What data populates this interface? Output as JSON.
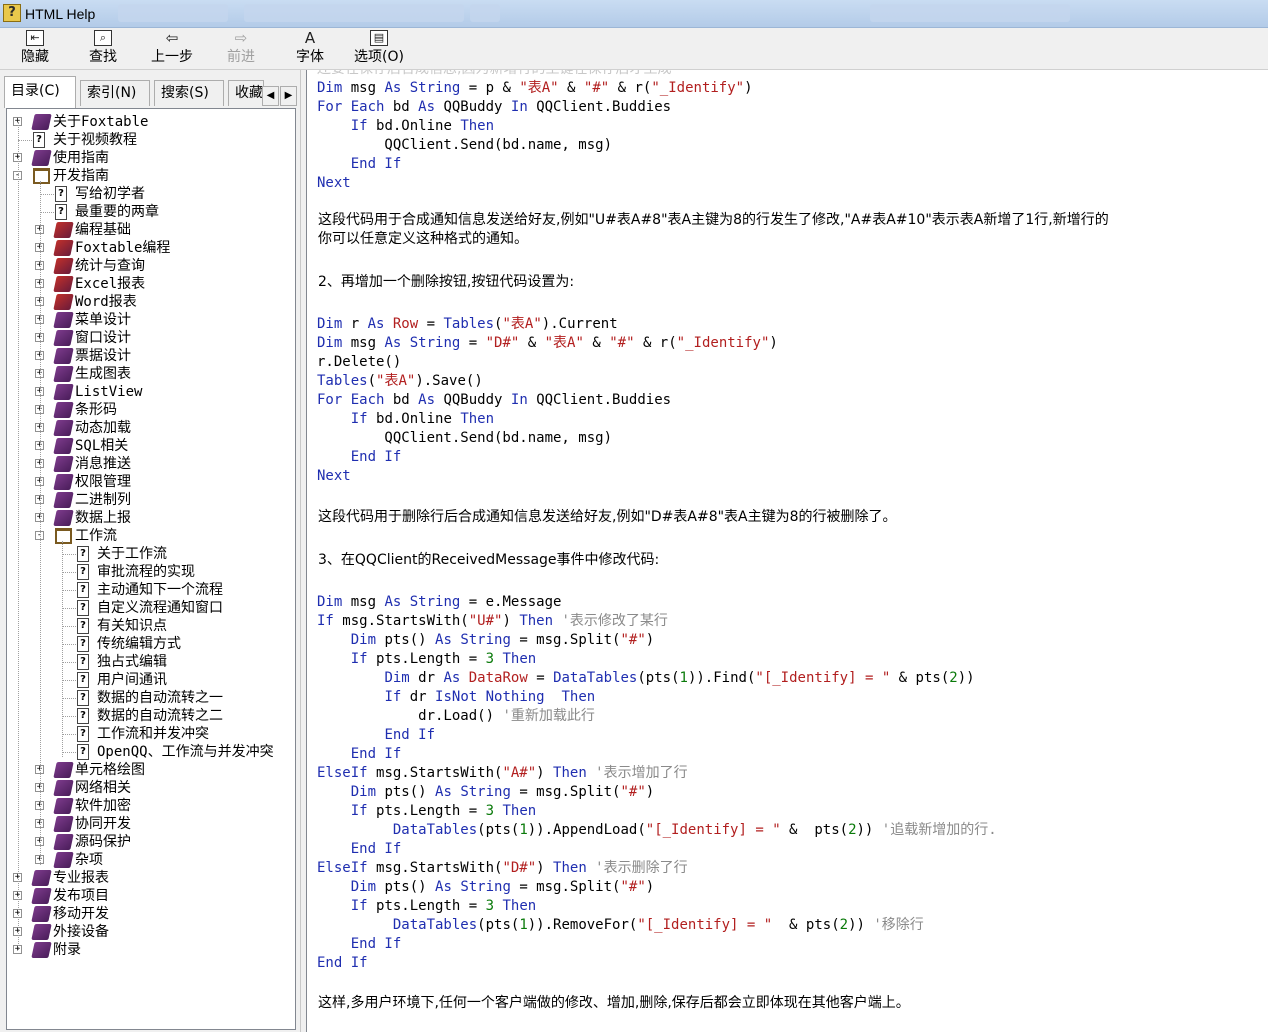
{
  "window": {
    "title": "HTML Help"
  },
  "toolbar": {
    "hide": "隐藏",
    "find": "查找",
    "back": "上一步",
    "forward": "前进",
    "font": "字体",
    "options": "选项(O)"
  },
  "nav": {
    "tabs": [
      "目录(C)",
      "索引(N)",
      "搜索(S)",
      "收藏"
    ],
    "tree": [
      {
        "label": "关于Foxtable",
        "level": 0,
        "icon": "book",
        "expander": "+"
      },
      {
        "label": "关于视频教程",
        "level": 0,
        "icon": "page",
        "expander": ""
      },
      {
        "label": "使用指南",
        "level": 0,
        "icon": "book",
        "expander": "+"
      },
      {
        "label": "开发指南",
        "level": 0,
        "icon": "openbook",
        "expander": "-"
      },
      {
        "label": "写给初学者",
        "level": 1,
        "icon": "page",
        "expander": ""
      },
      {
        "label": "最重要的两章",
        "level": 1,
        "icon": "page",
        "expander": ""
      },
      {
        "label": "编程基础",
        "level": 1,
        "icon": "book-red",
        "expander": "+"
      },
      {
        "label": "Foxtable编程",
        "level": 1,
        "icon": "book-red",
        "expander": "+"
      },
      {
        "label": "统计与查询",
        "level": 1,
        "icon": "book-red",
        "expander": "+"
      },
      {
        "label": "Excel报表",
        "level": 1,
        "icon": "book-red",
        "expander": "+"
      },
      {
        "label": "Word报表",
        "level": 1,
        "icon": "book-red",
        "expander": "+"
      },
      {
        "label": "菜单设计",
        "level": 1,
        "icon": "book",
        "expander": "+"
      },
      {
        "label": "窗口设计",
        "level": 1,
        "icon": "book",
        "expander": "+"
      },
      {
        "label": "票据设计",
        "level": 1,
        "icon": "book",
        "expander": "+"
      },
      {
        "label": "生成图表",
        "level": 1,
        "icon": "book",
        "expander": "+"
      },
      {
        "label": "ListView",
        "level": 1,
        "icon": "book",
        "expander": "+"
      },
      {
        "label": "条形码",
        "level": 1,
        "icon": "book",
        "expander": "+"
      },
      {
        "label": "动态加载",
        "level": 1,
        "icon": "book",
        "expander": "+"
      },
      {
        "label": "SQL相关",
        "level": 1,
        "icon": "book",
        "expander": "+"
      },
      {
        "label": "消息推送",
        "level": 1,
        "icon": "book",
        "expander": "+"
      },
      {
        "label": "权限管理",
        "level": 1,
        "icon": "book",
        "expander": "+"
      },
      {
        "label": "二进制列",
        "level": 1,
        "icon": "book",
        "expander": "+"
      },
      {
        "label": "数据上报",
        "level": 1,
        "icon": "book",
        "expander": "+"
      },
      {
        "label": "工作流",
        "level": 1,
        "icon": "openbook",
        "expander": "-"
      },
      {
        "label": "关于工作流",
        "level": 2,
        "icon": "page",
        "expander": ""
      },
      {
        "label": "审批流程的实现",
        "level": 2,
        "icon": "page",
        "expander": ""
      },
      {
        "label": "主动通知下一个流程",
        "level": 2,
        "icon": "page",
        "expander": ""
      },
      {
        "label": "自定义流程通知窗口",
        "level": 2,
        "icon": "page",
        "expander": ""
      },
      {
        "label": "有关知识点",
        "level": 2,
        "icon": "page",
        "expander": ""
      },
      {
        "label": "传统编辑方式",
        "level": 2,
        "icon": "page",
        "expander": ""
      },
      {
        "label": "独占式编辑",
        "level": 2,
        "icon": "page",
        "expander": ""
      },
      {
        "label": "用户间通讯",
        "level": 2,
        "icon": "page",
        "expander": ""
      },
      {
        "label": "数据的自动流转之一",
        "level": 2,
        "icon": "page",
        "expander": ""
      },
      {
        "label": "数据的自动流转之二",
        "level": 2,
        "icon": "page",
        "expander": ""
      },
      {
        "label": "工作流和并发冲突",
        "level": 2,
        "icon": "page",
        "expander": ""
      },
      {
        "label": "OpenQQ、工作流与并发冲突",
        "level": 2,
        "icon": "page",
        "expander": ""
      },
      {
        "label": "单元格绘图",
        "level": 1,
        "icon": "book",
        "expander": "+"
      },
      {
        "label": "网络相关",
        "level": 1,
        "icon": "book",
        "expander": "+"
      },
      {
        "label": "软件加密",
        "level": 1,
        "icon": "book",
        "expander": "+"
      },
      {
        "label": "协同开发",
        "level": 1,
        "icon": "book",
        "expander": "+"
      },
      {
        "label": "源码保护",
        "level": 1,
        "icon": "book",
        "expander": "+"
      },
      {
        "label": "杂项",
        "level": 1,
        "icon": "book",
        "expander": "+"
      },
      {
        "label": "专业报表",
        "level": 0,
        "icon": "book",
        "expander": "+"
      },
      {
        "label": "发布项目",
        "level": 0,
        "icon": "book",
        "expander": "+"
      },
      {
        "label": "移动开发",
        "level": 0,
        "icon": "book",
        "expander": "+"
      },
      {
        "label": "外接设备",
        "level": 0,
        "icon": "book",
        "expander": "+"
      },
      {
        "label": "附录",
        "level": 0,
        "icon": "book",
        "expander": "+"
      }
    ]
  },
  "content": {
    "top_faded": "还要在保存后合成信息,因为新增行的主键在保存后才生成",
    "block1": [
      [
        {
          "t": "Dim ",
          "c": "kw"
        },
        {
          "t": "msg "
        },
        {
          "t": "As ",
          "c": "kw"
        },
        {
          "t": "String",
          "c": "ty"
        },
        {
          "t": " = p & "
        },
        {
          "t": "\"表A\"",
          "c": "st"
        },
        {
          "t": " & "
        },
        {
          "t": "\"#\"",
          "c": "st"
        },
        {
          "t": " & r("
        },
        {
          "t": "\"_Identify\"",
          "c": "st"
        },
        {
          "t": ")"
        }
      ],
      [
        {
          "t": "For Each ",
          "c": "kw"
        },
        {
          "t": "bd "
        },
        {
          "t": "As ",
          "c": "kw"
        },
        {
          "t": "QQBuddy "
        },
        {
          "t": "In ",
          "c": "kw"
        },
        {
          "t": "QQClient.Buddies"
        }
      ],
      [
        {
          "t": "    "
        },
        {
          "t": "If ",
          "c": "kw"
        },
        {
          "t": "bd.Online "
        },
        {
          "t": "Then",
          "c": "kw"
        }
      ],
      [
        {
          "t": "        QQClient.Send(bd.name, msg)"
        }
      ],
      [
        {
          "t": "    "
        },
        {
          "t": "End If",
          "c": "kw"
        }
      ],
      [
        {
          "t": "Next",
          "c": "kw"
        }
      ]
    ],
    "para1_line1": "这段代码用于合成通知信息发送给好友,例如\"U#表A#8\"表A主键为8的行发生了修改,\"A#表A#10\"表示表A新增了1行,新增行的",
    "para1_line2": "你可以任意定义这种格式的通知。",
    "step2": "2、再增加一个删除按钮,按钮代码设置为:",
    "block2": [
      [
        {
          "t": "Dim ",
          "c": "kw"
        },
        {
          "t": "r "
        },
        {
          "t": "As ",
          "c": "kw"
        },
        {
          "t": "Row",
          "c": "st"
        },
        {
          "t": " = "
        },
        {
          "t": "Tables",
          "c": "ty"
        },
        {
          "t": "("
        },
        {
          "t": "\"表A\"",
          "c": "st"
        },
        {
          "t": ").Current"
        }
      ],
      [
        {
          "t": "Dim ",
          "c": "kw"
        },
        {
          "t": "msg "
        },
        {
          "t": "As ",
          "c": "kw"
        },
        {
          "t": "String",
          "c": "ty"
        },
        {
          "t": " = "
        },
        {
          "t": "\"D#\"",
          "c": "st"
        },
        {
          "t": " & "
        },
        {
          "t": "\"表A\"",
          "c": "st"
        },
        {
          "t": " & "
        },
        {
          "t": "\"#\"",
          "c": "st"
        },
        {
          "t": " & r("
        },
        {
          "t": "\"_Identify\"",
          "c": "st"
        },
        {
          "t": ")"
        }
      ],
      [
        {
          "t": "r.Delete()"
        }
      ],
      [
        {
          "t": "Tables",
          "c": "ty"
        },
        {
          "t": "("
        },
        {
          "t": "\"表A\"",
          "c": "st"
        },
        {
          "t": ").Save()"
        }
      ],
      [
        {
          "t": "For Each ",
          "c": "kw"
        },
        {
          "t": "bd "
        },
        {
          "t": "As ",
          "c": "kw"
        },
        {
          "t": "QQBuddy "
        },
        {
          "t": "In ",
          "c": "kw"
        },
        {
          "t": "QQClient.Buddies"
        }
      ],
      [
        {
          "t": "    "
        },
        {
          "t": "If ",
          "c": "kw"
        },
        {
          "t": "bd.Online "
        },
        {
          "t": "Then",
          "c": "kw"
        }
      ],
      [
        {
          "t": "        QQClient.Send(bd.name, msg)"
        }
      ],
      [
        {
          "t": "    "
        },
        {
          "t": "End If",
          "c": "kw"
        }
      ],
      [
        {
          "t": "Next",
          "c": "kw"
        }
      ]
    ],
    "para2": "这段代码用于删除行后合成通知信息发送给好友,例如\"D#表A#8\"表A主键为8的行被删除了。",
    "step3": "3、在QQClient的ReceivedMessage事件中修改代码:",
    "block3": [
      [
        {
          "t": "Dim ",
          "c": "kw"
        },
        {
          "t": "msg "
        },
        {
          "t": "As ",
          "c": "kw"
        },
        {
          "t": "String",
          "c": "ty"
        },
        {
          "t": " = e.Message"
        }
      ],
      [
        {
          "t": "If ",
          "c": "kw"
        },
        {
          "t": "msg.StartsWith("
        },
        {
          "t": "\"U#\"",
          "c": "st"
        },
        {
          "t": ") "
        },
        {
          "t": "Then",
          "c": "kw"
        },
        {
          "t": " '表示修改了某行",
          "c": "cm"
        }
      ],
      [
        {
          "t": "    "
        },
        {
          "t": "Dim ",
          "c": "kw"
        },
        {
          "t": "pts() "
        },
        {
          "t": "As ",
          "c": "kw"
        },
        {
          "t": "String",
          "c": "ty"
        },
        {
          "t": " = msg.Split("
        },
        {
          "t": "\"#\"",
          "c": "st"
        },
        {
          "t": ")"
        }
      ],
      [
        {
          "t": "    "
        },
        {
          "t": "If ",
          "c": "kw"
        },
        {
          "t": "pts.Length = "
        },
        {
          "t": "3",
          "c": "nm"
        },
        {
          "t": " "
        },
        {
          "t": "Then",
          "c": "kw"
        }
      ],
      [
        {
          "t": "        "
        },
        {
          "t": "Dim ",
          "c": "kw"
        },
        {
          "t": "dr "
        },
        {
          "t": "As ",
          "c": "kw"
        },
        {
          "t": "DataRow",
          "c": "st"
        },
        {
          "t": " = "
        },
        {
          "t": "DataTables",
          "c": "ty"
        },
        {
          "t": "(pts("
        },
        {
          "t": "1",
          "c": "nm"
        },
        {
          "t": ")).Find("
        },
        {
          "t": "\"[_Identify] = \"",
          "c": "st"
        },
        {
          "t": " & pts("
        },
        {
          "t": "2",
          "c": "nm"
        },
        {
          "t": "))"
        }
      ],
      [
        {
          "t": "        "
        },
        {
          "t": "If ",
          "c": "kw"
        },
        {
          "t": "dr "
        },
        {
          "t": "IsNot Nothing  Then",
          "c": "kw"
        }
      ],
      [
        {
          "t": "            dr.Load()"
        },
        {
          "t": " '重新加载此行",
          "c": "cm"
        }
      ],
      [
        {
          "t": "        "
        },
        {
          "t": "End If",
          "c": "kw"
        }
      ],
      [
        {
          "t": "    "
        },
        {
          "t": "End If",
          "c": "kw"
        }
      ],
      [
        {
          "t": "ElseIf ",
          "c": "kw"
        },
        {
          "t": "msg.StartsWith("
        },
        {
          "t": "\"A#\"",
          "c": "st"
        },
        {
          "t": ") "
        },
        {
          "t": "Then",
          "c": "kw"
        },
        {
          "t": " '表示增加了行",
          "c": "cm"
        }
      ],
      [
        {
          "t": "    "
        },
        {
          "t": "Dim ",
          "c": "kw"
        },
        {
          "t": "pts() "
        },
        {
          "t": "As ",
          "c": "kw"
        },
        {
          "t": "String",
          "c": "ty"
        },
        {
          "t": " = msg.Split("
        },
        {
          "t": "\"#\"",
          "c": "st"
        },
        {
          "t": ")"
        }
      ],
      [
        {
          "t": "    "
        },
        {
          "t": "If ",
          "c": "kw"
        },
        {
          "t": "pts.Length = "
        },
        {
          "t": "3",
          "c": "nm"
        },
        {
          "t": " "
        },
        {
          "t": "Then",
          "c": "kw"
        }
      ],
      [
        {
          "t": "         "
        },
        {
          "t": "DataTables",
          "c": "ty"
        },
        {
          "t": "(pts("
        },
        {
          "t": "1",
          "c": "nm"
        },
        {
          "t": ")).AppendLoad("
        },
        {
          "t": "\"[_Identify] = \"",
          "c": "st"
        },
        {
          "t": " &  pts("
        },
        {
          "t": "2",
          "c": "nm"
        },
        {
          "t": "))"
        },
        {
          "t": " '追载新增加的行.",
          "c": "cm"
        }
      ],
      [
        {
          "t": "    "
        },
        {
          "t": "End If",
          "c": "kw"
        }
      ],
      [
        {
          "t": "ElseIf ",
          "c": "kw"
        },
        {
          "t": "msg.StartsWith("
        },
        {
          "t": "\"D#\"",
          "c": "st"
        },
        {
          "t": ") "
        },
        {
          "t": "Then",
          "c": "kw"
        },
        {
          "t": " '表示删除了行",
          "c": "cm"
        }
      ],
      [
        {
          "t": "    "
        },
        {
          "t": "Dim ",
          "c": "kw"
        },
        {
          "t": "pts() "
        },
        {
          "t": "As ",
          "c": "kw"
        },
        {
          "t": "String",
          "c": "ty"
        },
        {
          "t": " = msg.Split("
        },
        {
          "t": "\"#\"",
          "c": "st"
        },
        {
          "t": ")"
        }
      ],
      [
        {
          "t": "    "
        },
        {
          "t": "If ",
          "c": "kw"
        },
        {
          "t": "pts.Length = "
        },
        {
          "t": "3",
          "c": "nm"
        },
        {
          "t": " "
        },
        {
          "t": "Then",
          "c": "kw"
        }
      ],
      [
        {
          "t": "         "
        },
        {
          "t": "DataTables",
          "c": "ty"
        },
        {
          "t": "(pts("
        },
        {
          "t": "1",
          "c": "nm"
        },
        {
          "t": ")).RemoveFor("
        },
        {
          "t": "\"[_Identify] = \"",
          "c": "st"
        },
        {
          "t": "  & pts("
        },
        {
          "t": "2",
          "c": "nm"
        },
        {
          "t": "))"
        },
        {
          "t": " '移除行",
          "c": "cm"
        }
      ],
      [
        {
          "t": "    "
        },
        {
          "t": "End If",
          "c": "kw"
        }
      ],
      [
        {
          "t": "End If",
          "c": "kw"
        }
      ]
    ],
    "para3": "这样,多用户环境下,任何一个客户端做的修改、增加,删除,保存后都会立即体现在其他客户端上。"
  }
}
